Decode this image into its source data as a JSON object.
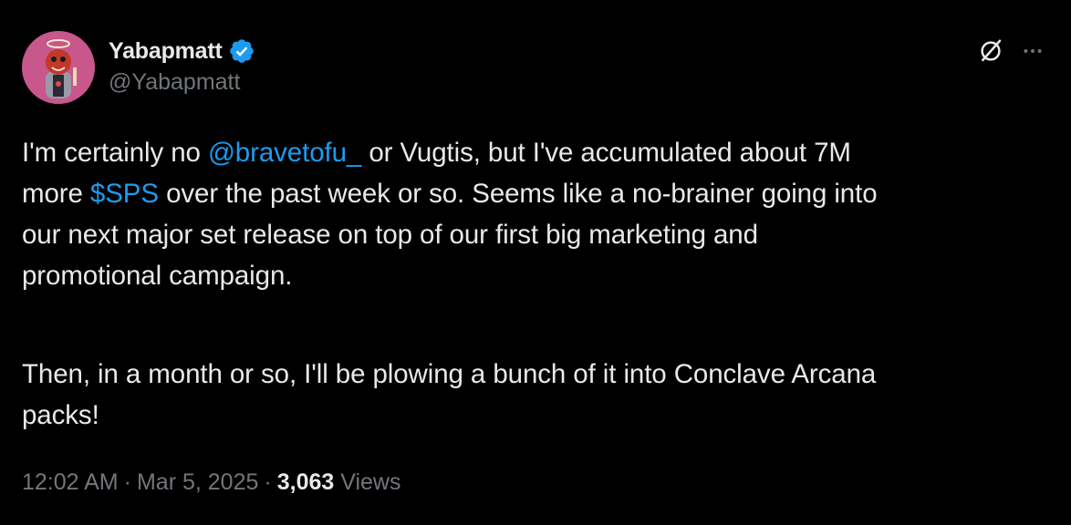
{
  "author": {
    "display_name": "Yabapmatt",
    "handle": "@Yabapmatt",
    "verified": true,
    "verified_color": "#1d9bf0"
  },
  "tweet": {
    "line1_before": "I'm certainly no ",
    "mention": "@bravetofu_",
    "line1_after": " or Vugtis, but I've accumulated about 7M",
    "line2_before": "more ",
    "cashtag": "$SPS",
    "line2_after": " over the past week or so. Seems like a no-brainer going into",
    "line3": "our next major set release on top of our first big marketing and",
    "line4": "promotional campaign.",
    "line5": "Then, in a month or so, I'll be plowing a bunch of it into Conclave Arcana",
    "line6": "packs!"
  },
  "meta": {
    "time": "12:02 AM",
    "separator1": "·",
    "date": "Mar 5, 2025",
    "separator2": "·",
    "views_count": "3,063",
    "views_label": "Views"
  },
  "icons": {
    "grok": "grok-icon",
    "more": "more-icon",
    "verified": "verified-badge-icon"
  },
  "colors": {
    "background": "#000000",
    "text": "#e7e9ea",
    "secondary": "#71767b",
    "link": "#1d9bf0"
  }
}
